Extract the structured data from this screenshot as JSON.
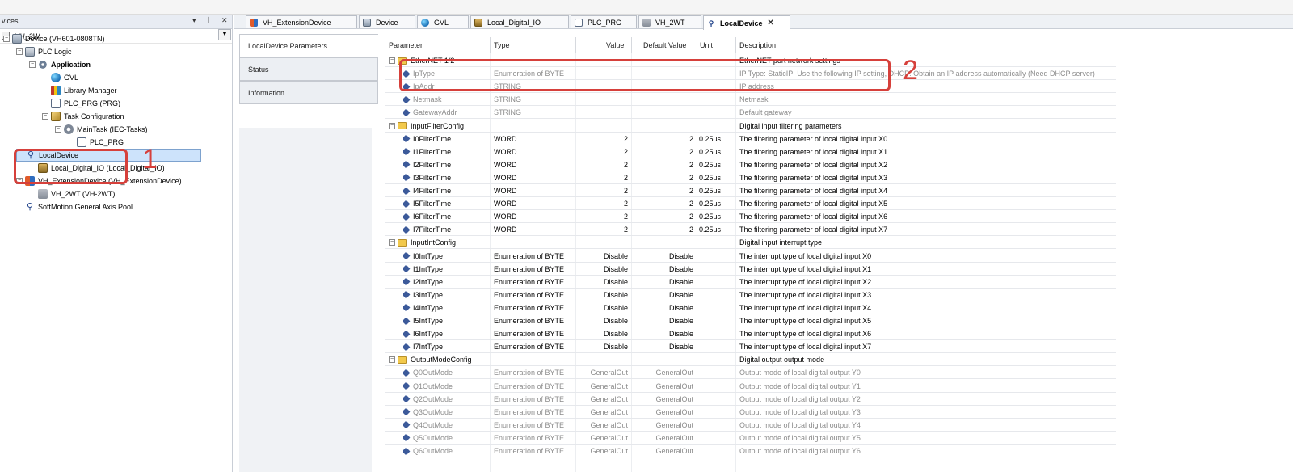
{
  "devices_pane": {
    "title": "vices",
    "pin_glyphs": [
      "▾",
      "ᛁ",
      "✕"
    ],
    "project": "VH_2W",
    "tree": [
      {
        "label": "Device (VH601-0808TN)",
        "indent": 0,
        "expander": "⊟",
        "icon": "device-icon"
      },
      {
        "label": "PLC Logic",
        "indent": 1,
        "expander": "⊟",
        "icon": "plc-logic-icon"
      },
      {
        "label": "Application",
        "indent": 2,
        "expander": "⊟",
        "icon": "application-icon",
        "bold": true
      },
      {
        "label": "GVL",
        "indent": 3,
        "icon": "gvl-icon"
      },
      {
        "label": "Library Manager",
        "indent": 3,
        "icon": "library-manager-icon"
      },
      {
        "label": "PLC_PRG (PRG)",
        "indent": 3,
        "icon": "program-icon"
      },
      {
        "label": "Task Configuration",
        "indent": 3,
        "expander": "⊟",
        "icon": "task-config-icon"
      },
      {
        "label": "MainTask (IEC-Tasks)",
        "indent": 4,
        "expander": "⊟",
        "icon": "maintask-icon"
      },
      {
        "label": "PLC_PRG",
        "indent": 5,
        "icon": "program-icon"
      },
      {
        "label": "LocalDevice",
        "indent": 1,
        "icon": "local-device-icon",
        "selected": true
      },
      {
        "label": "Local_Digital_IO (Local_Digital_IO)",
        "indent": 2,
        "icon": "io-module-icon"
      },
      {
        "label": "VH_ExtensionDevice (VH_ExtensionDevice)",
        "indent": 1,
        "expander": "⊟",
        "icon": "extension-device-icon"
      },
      {
        "label": "VH_2WT (VH-2WT)",
        "indent": 2,
        "icon": "module-2wt-icon"
      },
      {
        "label": "SoftMotion General Axis Pool",
        "indent": 1,
        "icon": "axis-pool-icon"
      }
    ]
  },
  "tabs": [
    {
      "label": "VH_ExtensionDevice",
      "icon": "extension-device-icon"
    },
    {
      "label": "Device",
      "icon": "device-icon"
    },
    {
      "label": "GVL",
      "icon": "gvl-icon"
    },
    {
      "label": "Local_Digital_IO",
      "icon": "io-module-icon"
    },
    {
      "label": "PLC_PRG",
      "icon": "program-icon"
    },
    {
      "label": "VH_2WT",
      "icon": "module-2wt-icon"
    },
    {
      "label": "LocalDevice",
      "icon": "local-device-icon",
      "active": true,
      "close": "✕"
    }
  ],
  "side_tabs": [
    "LocalDevice Parameters",
    "Status",
    "Information"
  ],
  "table": {
    "headers": {
      "parameter": "Parameter",
      "type": "Type",
      "value": "Value",
      "default": "Default Value",
      "unit": "Unit",
      "description": "Description"
    },
    "rows": [
      {
        "kind": "group",
        "name": "EtherNET 1/2",
        "desc": "EtherNET port network settings"
      },
      {
        "kind": "param",
        "dim": true,
        "name": "IpType",
        "type": "Enumeration of BYTE",
        "value": "",
        "default": "",
        "unit": "",
        "desc": "IP Type: StaticIP: Use the following IP setting, DHCP: Obtain an IP address automatically (Need DHCP server)"
      },
      {
        "kind": "param",
        "dim": true,
        "name": "IpAddr",
        "type": "STRING",
        "value": "",
        "default": "",
        "unit": "",
        "desc": "IP address"
      },
      {
        "kind": "param",
        "dim": true,
        "name": "Netmask",
        "type": "STRING",
        "value": "",
        "default": "",
        "unit": "",
        "desc": "Netmask"
      },
      {
        "kind": "param",
        "dim": true,
        "name": "GatewayAddr",
        "type": "STRING",
        "value": "",
        "default": "",
        "unit": "",
        "desc": "Default gateway"
      },
      {
        "kind": "group",
        "name": "InputFilterConfig",
        "desc": "Digital input filtering parameters"
      },
      {
        "kind": "param",
        "name": "I0FilterTime",
        "type": "WORD",
        "value": "2",
        "default": "2",
        "unit": "0.25us",
        "desc": "The filtering parameter of local digital input X0"
      },
      {
        "kind": "param",
        "name": "I1FilterTime",
        "type": "WORD",
        "value": "2",
        "default": "2",
        "unit": "0.25us",
        "desc": "The filtering parameter of local digital input X1"
      },
      {
        "kind": "param",
        "name": "I2FilterTime",
        "type": "WORD",
        "value": "2",
        "default": "2",
        "unit": "0.25us",
        "desc": "The filtering parameter of local digital input X2"
      },
      {
        "kind": "param",
        "name": "I3FilterTime",
        "type": "WORD",
        "value": "2",
        "default": "2",
        "unit": "0.25us",
        "desc": "The filtering parameter of local digital input X3"
      },
      {
        "kind": "param",
        "name": "I4FilterTime",
        "type": "WORD",
        "value": "2",
        "default": "2",
        "unit": "0.25us",
        "desc": "The filtering parameter of local digital input X4"
      },
      {
        "kind": "param",
        "name": "I5FilterTime",
        "type": "WORD",
        "value": "2",
        "default": "2",
        "unit": "0.25us",
        "desc": "The filtering parameter of local digital input X5"
      },
      {
        "kind": "param",
        "name": "I6FilterTime",
        "type": "WORD",
        "value": "2",
        "default": "2",
        "unit": "0.25us",
        "desc": "The filtering parameter of local digital input X6"
      },
      {
        "kind": "param",
        "name": "I7FilterTime",
        "type": "WORD",
        "value": "2",
        "default": "2",
        "unit": "0.25us",
        "desc": "The filtering parameter of local digital input X7"
      },
      {
        "kind": "group",
        "name": "InputIntConfig",
        "desc": "Digital input interrupt type"
      },
      {
        "kind": "param",
        "name": "I0IntType",
        "type": "Enumeration of BYTE",
        "value": "Disable",
        "default": "Disable",
        "unit": "",
        "desc": "The interrupt type of local digital input X0"
      },
      {
        "kind": "param",
        "name": "I1IntType",
        "type": "Enumeration of BYTE",
        "value": "Disable",
        "default": "Disable",
        "unit": "",
        "desc": "The interrupt type of local digital input X1"
      },
      {
        "kind": "param",
        "name": "I2IntType",
        "type": "Enumeration of BYTE",
        "value": "Disable",
        "default": "Disable",
        "unit": "",
        "desc": "The interrupt type of local digital input X2"
      },
      {
        "kind": "param",
        "name": "I3IntType",
        "type": "Enumeration of BYTE",
        "value": "Disable",
        "default": "Disable",
        "unit": "",
        "desc": "The interrupt type of local digital input X3"
      },
      {
        "kind": "param",
        "name": "I4IntType",
        "type": "Enumeration of BYTE",
        "value": "Disable",
        "default": "Disable",
        "unit": "",
        "desc": "The interrupt type of local digital input X4"
      },
      {
        "kind": "param",
        "name": "I5IntType",
        "type": "Enumeration of BYTE",
        "value": "Disable",
        "default": "Disable",
        "unit": "",
        "desc": "The interrupt type of local digital input X5"
      },
      {
        "kind": "param",
        "name": "I6IntType",
        "type": "Enumeration of BYTE",
        "value": "Disable",
        "default": "Disable",
        "unit": "",
        "desc": "The interrupt type of local digital input X6"
      },
      {
        "kind": "param",
        "name": "I7IntType",
        "type": "Enumeration of BYTE",
        "value": "Disable",
        "default": "Disable",
        "unit": "",
        "desc": "The interrupt type of local digital input X7"
      },
      {
        "kind": "group",
        "name": "OutputModeConfig",
        "desc": "Digital output output mode"
      },
      {
        "kind": "param",
        "dim": true,
        "name": "Q0OutMode",
        "type": "Enumeration of BYTE",
        "value": "GeneralOut",
        "default": "GeneralOut",
        "unit": "",
        "desc": "Output mode of local digital output Y0"
      },
      {
        "kind": "param",
        "dim": true,
        "name": "Q1OutMode",
        "type": "Enumeration of BYTE",
        "value": "GeneralOut",
        "default": "GeneralOut",
        "unit": "",
        "desc": "Output mode of local digital output Y1"
      },
      {
        "kind": "param",
        "dim": true,
        "name": "Q2OutMode",
        "type": "Enumeration of BYTE",
        "value": "GeneralOut",
        "default": "GeneralOut",
        "unit": "",
        "desc": "Output mode of local digital output Y2"
      },
      {
        "kind": "param",
        "dim": true,
        "name": "Q3OutMode",
        "type": "Enumeration of BYTE",
        "value": "GeneralOut",
        "default": "GeneralOut",
        "unit": "",
        "desc": "Output mode of local digital output Y3"
      },
      {
        "kind": "param",
        "dim": true,
        "name": "Q4OutMode",
        "type": "Enumeration of BYTE",
        "value": "GeneralOut",
        "default": "GeneralOut",
        "unit": "",
        "desc": "Output mode of local digital output Y4"
      },
      {
        "kind": "param",
        "dim": true,
        "name": "Q5OutMode",
        "type": "Enumeration of BYTE",
        "value": "GeneralOut",
        "default": "GeneralOut",
        "unit": "",
        "desc": "Output mode of local digital output Y5"
      },
      {
        "kind": "param",
        "dim": true,
        "name": "Q6OutMode",
        "type": "Enumeration of BYTE",
        "value": "GeneralOut",
        "default": "GeneralOut",
        "unit": "",
        "desc": "Output mode of local digital output Y6"
      }
    ]
  },
  "annotations": {
    "marker_1": "1",
    "marker_2": "2",
    "color": "#d6403b"
  }
}
